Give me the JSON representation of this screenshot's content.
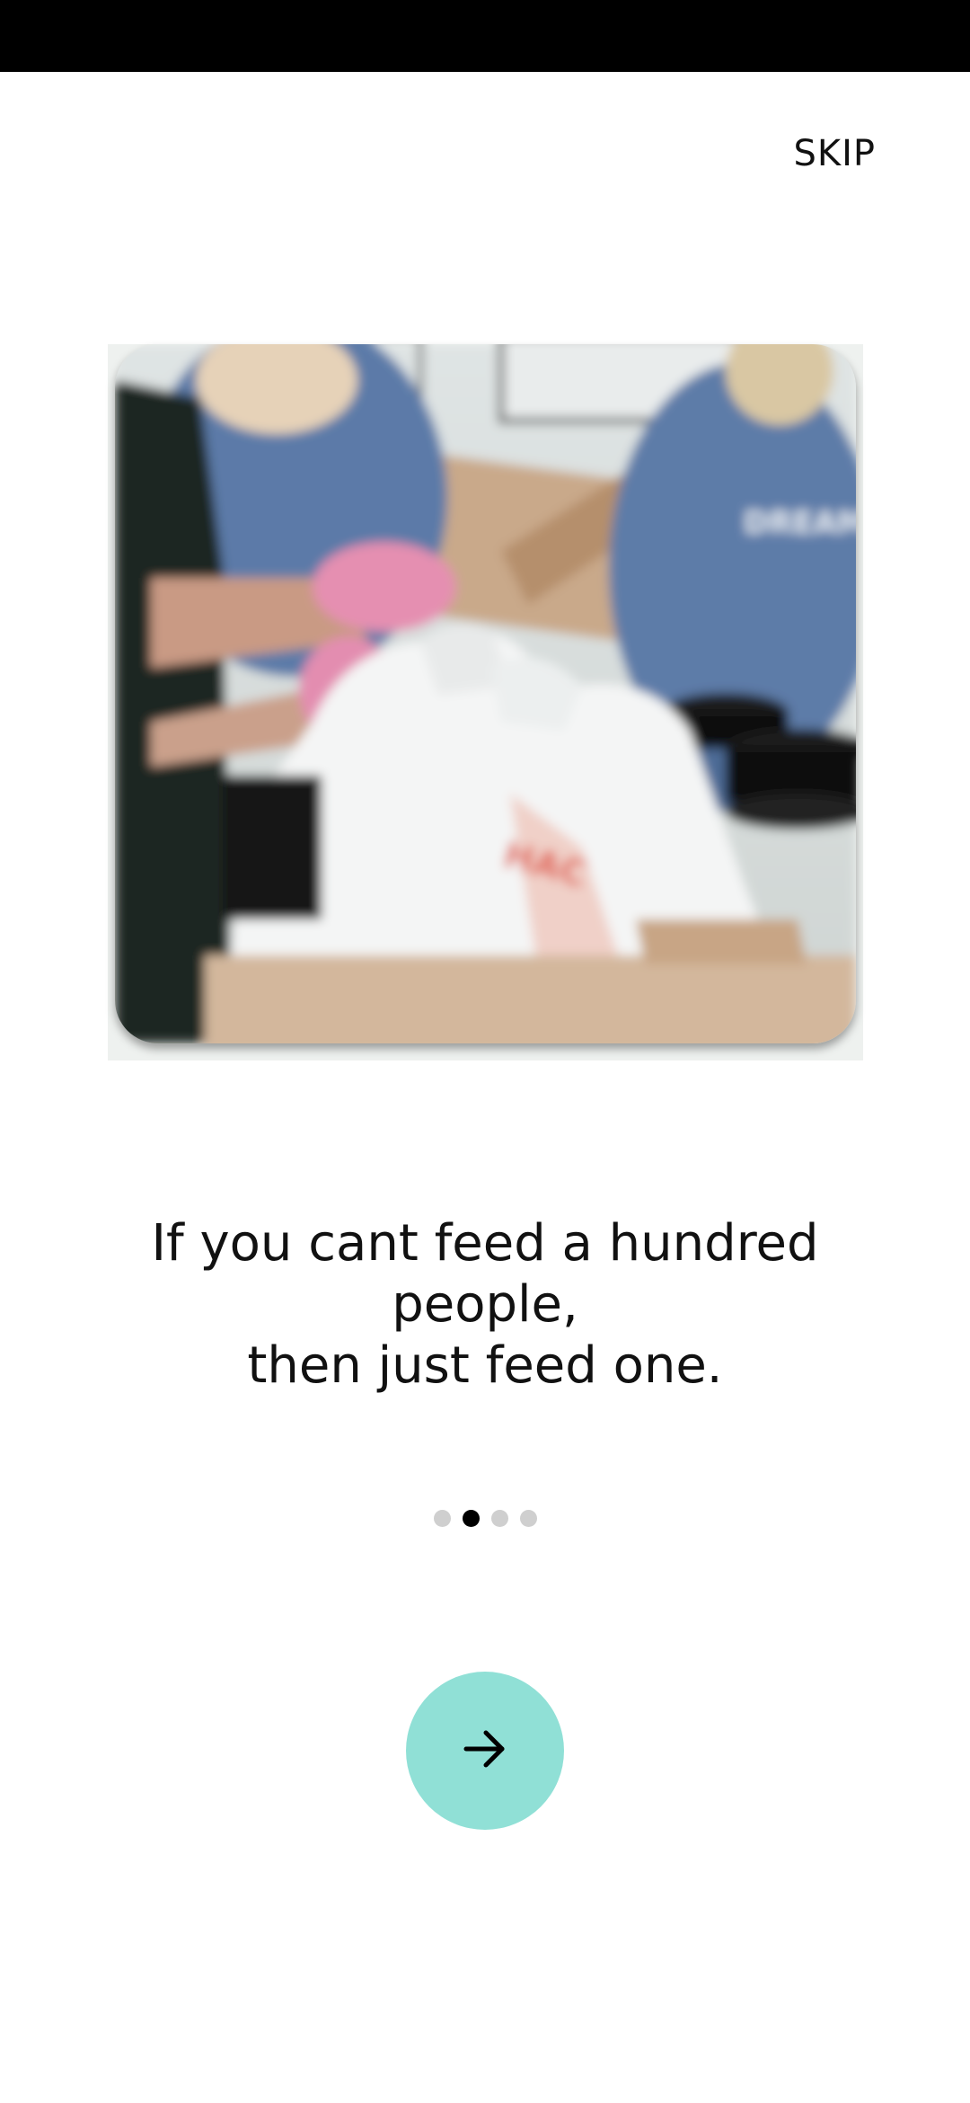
{
  "header": {
    "skip_label": "SKIP"
  },
  "slide": {
    "image_subject": "volunteers-packing-food-bags",
    "quote": "If you cant feed a hundred people,\n then just feed one."
  },
  "pager": {
    "total": 4,
    "active_index": 1
  },
  "actions": {
    "next_icon": "arrow-right-icon",
    "next_button_color": "#90e0d6"
  }
}
